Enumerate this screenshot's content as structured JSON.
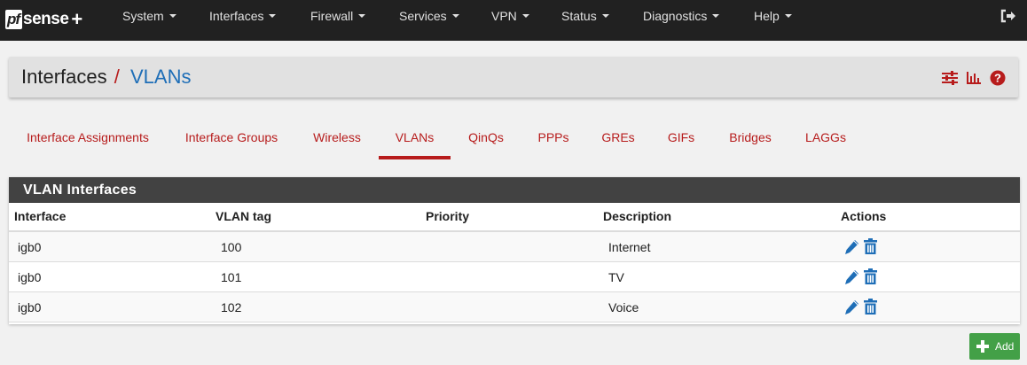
{
  "brand": {
    "prefix": "pf",
    "name": "sense",
    "plus": "+"
  },
  "nav": {
    "items": [
      {
        "label": "System"
      },
      {
        "label": "Interfaces"
      },
      {
        "label": "Firewall"
      },
      {
        "label": "Services"
      },
      {
        "label": "VPN"
      },
      {
        "label": "Status"
      },
      {
        "label": "Diagnostics"
      },
      {
        "label": "Help"
      }
    ],
    "logout_icon": "sign-out-icon"
  },
  "breadcrumb": {
    "section": "Interfaces",
    "separator": "/",
    "page": "VLANs",
    "icons": [
      "sliders-icon",
      "bar-chart-icon",
      "question-circle-icon"
    ]
  },
  "tabs": [
    {
      "label": "Interface Assignments",
      "active": false
    },
    {
      "label": "Interface Groups",
      "active": false
    },
    {
      "label": "Wireless",
      "active": false
    },
    {
      "label": "VLANs",
      "active": true
    },
    {
      "label": "QinQs",
      "active": false
    },
    {
      "label": "PPPs",
      "active": false
    },
    {
      "label": "GREs",
      "active": false
    },
    {
      "label": "GIFs",
      "active": false
    },
    {
      "label": "Bridges",
      "active": false
    },
    {
      "label": "LAGGs",
      "active": false
    }
  ],
  "panel": {
    "title": "VLAN Interfaces",
    "columns": [
      "Interface",
      "VLAN tag",
      "Priority",
      "Description",
      "Actions"
    ],
    "rows": [
      {
        "interface": "igb0",
        "tag": "100",
        "priority": "",
        "description": "Internet"
      },
      {
        "interface": "igb0",
        "tag": "101",
        "priority": "",
        "description": "TV"
      },
      {
        "interface": "igb0",
        "tag": "102",
        "priority": "",
        "description": "Voice"
      }
    ],
    "row_icons": [
      "pencil-icon",
      "trash-icon"
    ]
  },
  "add_button": {
    "label": "Add",
    "icon": "plus-icon"
  },
  "colors": {
    "navbar": "#212121",
    "accent_red": "#b71c1c",
    "link_blue": "#1e6eb7",
    "panel_heading": "#424242",
    "add_green": "#43a047"
  }
}
